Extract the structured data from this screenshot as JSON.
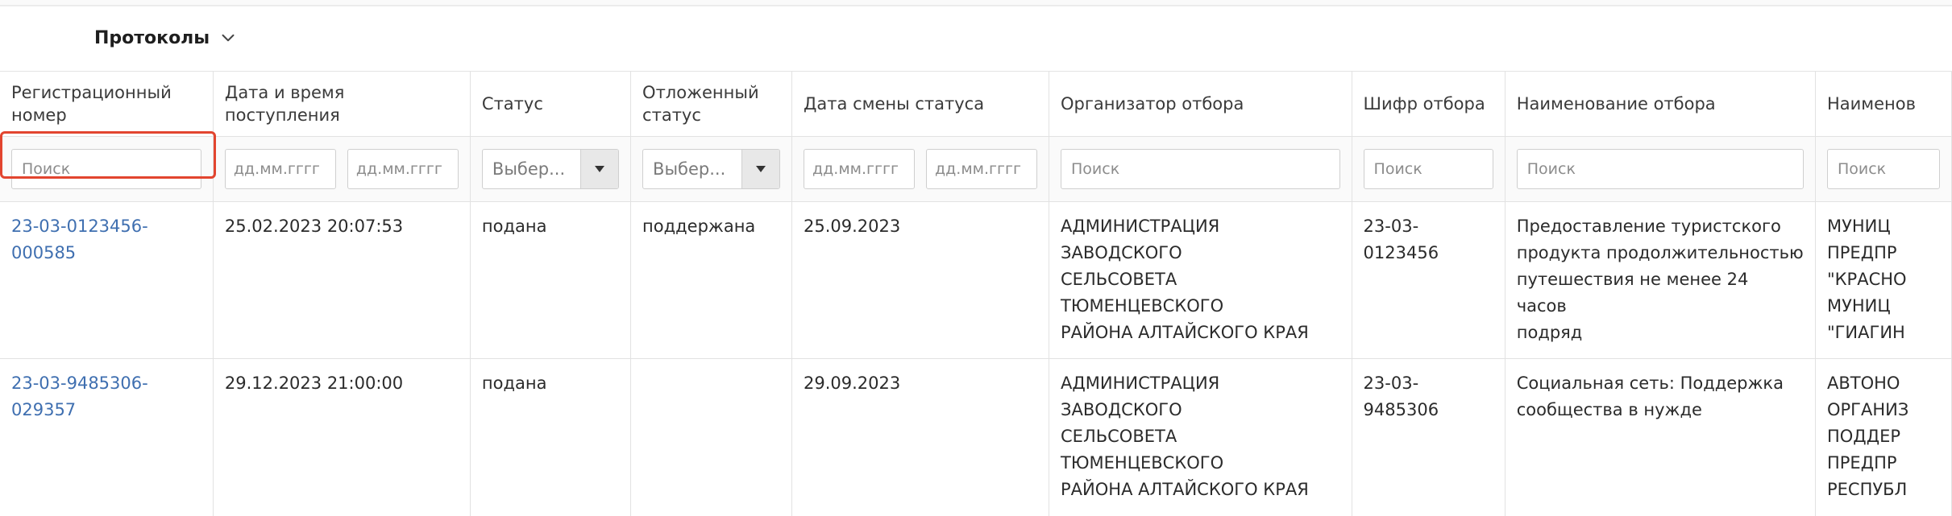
{
  "toolbar": {
    "view_label": "Протоколы",
    "view_icon": "chevron-down-icon"
  },
  "columns": [
    "Регистрационный номер",
    "Дата и время поступления",
    "Статус",
    "Отложенный статус",
    "Дата смены статуса",
    "Организатор отбора",
    "Шифр отбора",
    "Наименование отбора",
    "Наименов"
  ],
  "filters": {
    "search_placeholder": "Поиск",
    "date_placeholder": "дд.мм.гггг",
    "select_placeholder": "Выбер..."
  },
  "rows": [
    {
      "reg_number": "23-03-0123456-000585",
      "received": "25.02.2023 20:07:53",
      "status": "подана",
      "deferred_status": "поддержана",
      "status_changed": "25.09.2023",
      "organizer": [
        "АДМИНИСТРАЦИЯ ЗАВОДСКОГО",
        "СЕЛЬСОВЕТА ТЮМЕНЦЕВСКОГО",
        "РАЙОНА АЛТАЙСКОГО КРАЯ"
      ],
      "code": "23-03-0123456",
      "title": [
        "Предоставление туристского",
        "продукта продолжительностью",
        "путешествия не менее 24 часов",
        "подряд"
      ],
      "next": [
        "МУНИЦ",
        "ПРЕДПР",
        "\"КРАСНО",
        "МУНИЦ",
        "\"ГИАГИН"
      ]
    },
    {
      "reg_number": "23-03-9485306-029357",
      "received": "29.12.2023 21:00:00",
      "status": "подана",
      "deferred_status": "",
      "status_changed": "29.09.2023",
      "organizer": [
        "АДМИНИСТРАЦИЯ ЗАВОДСКОГО",
        "СЕЛЬСОВЕТА ТЮМЕНЦЕВСКОГО",
        "РАЙОНА АЛТАЙСКОГО КРАЯ"
      ],
      "code": "23-03-9485306",
      "title": [
        "Социальная сеть: Поддержка",
        "сообщества в нужде"
      ],
      "next": [
        "АВТОНО",
        "ОРГАНИЗ",
        "ПОДДЕР",
        "ПРЕДПР",
        "РЕСПУБЛ"
      ]
    }
  ]
}
